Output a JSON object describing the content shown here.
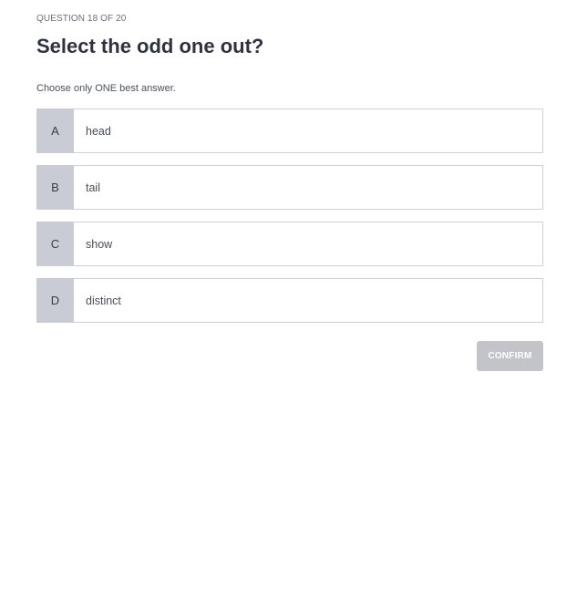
{
  "header": {
    "counter": "QUESTION 18 OF 20",
    "title": "Select the odd one out?",
    "instruction": "Choose only ONE best answer."
  },
  "options": [
    {
      "letter": "A",
      "text": "head"
    },
    {
      "letter": "B",
      "text": "tail"
    },
    {
      "letter": "C",
      "text": "show"
    },
    {
      "letter": "D",
      "text": "distinct"
    }
  ],
  "actions": {
    "confirm_label": "CONFIRM"
  },
  "colors": {
    "letter_bg": "#c9ccd4",
    "option_border": "#cfd1d6",
    "confirm_disabled_bg": "#c2c4ca",
    "title_text": "#2f333d"
  }
}
